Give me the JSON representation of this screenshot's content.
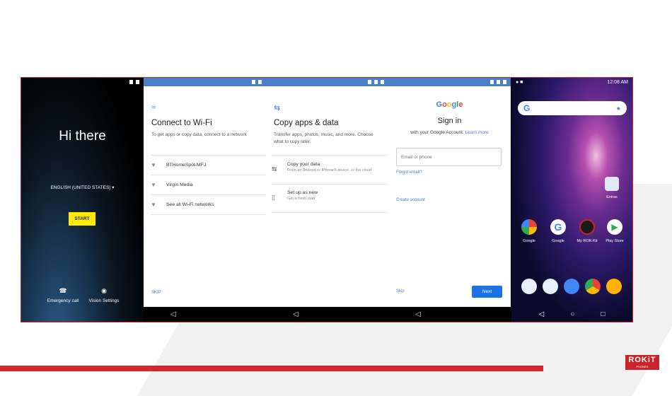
{
  "screen1": {
    "greeting": "Hi there",
    "language": "ENGLISH (UNITED STATES) ▾",
    "start_label": "START",
    "emergency_label": "Emergency call",
    "vision_label": "Vision Settings"
  },
  "wifi": {
    "title": "Connect to Wi-Fi",
    "subtitle": "To get apps or copy data, connect to a network",
    "networks": [
      "BTHomeSpot-MFJ",
      "Virgin Media",
      "See all Wi-Fi networks"
    ],
    "skip_label": "SKIP"
  },
  "copy": {
    "title": "Copy apps & data",
    "subtitle": "Transfer apps, photos, music, and more. Choose what to copy later.",
    "option1_title": "Copy your data",
    "option1_sub": "From an Android or iPhone® device, or the cloud",
    "option2_title": "Set up as new",
    "option2_sub": "Get a fresh start"
  },
  "signin": {
    "logo": "Google",
    "title": "Sign in",
    "with_account": "with your Google Account.",
    "learn_more": "Learn more",
    "email_placeholder": "Email or phone",
    "forgot_email": "Forgot email?",
    "create_account": "Create account",
    "skip_label": "Skip",
    "next_label": "Next"
  },
  "home": {
    "status_time": "12:08 AM",
    "apps": [
      "Google",
      "Google",
      "My ROK-Kit",
      "Play Store"
    ],
    "extras_label": "Extras"
  },
  "brand": {
    "logo_main": "ROKiT",
    "logo_sub": "PHONES"
  },
  "colors": {
    "accent_red": "#d9262c",
    "blue": "#4a80c8",
    "start_yellow": "#ffeb00"
  }
}
